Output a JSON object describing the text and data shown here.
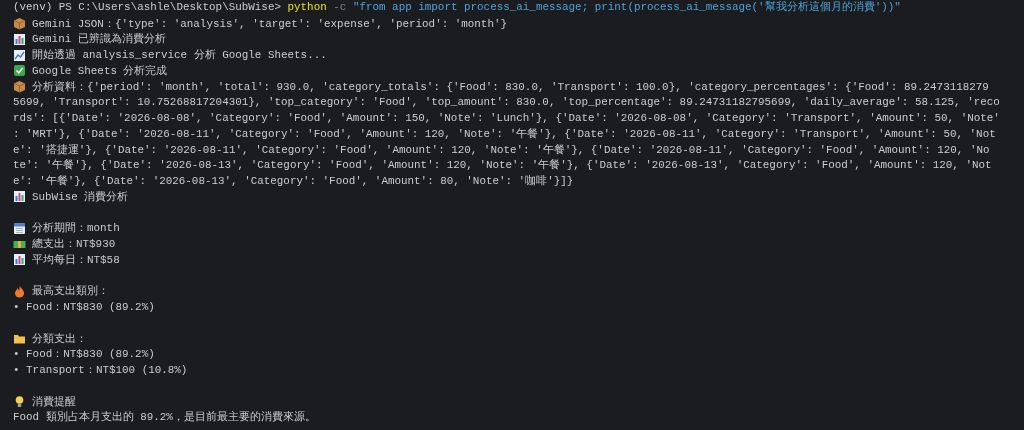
{
  "command": {
    "prompt": "(venv) PS C:\\Users\\ashle\\Desktop\\SubWise>",
    "program": "python",
    "flag": "-c",
    "argument": "\"from app import process_ai_message; print(process_ai_message('幫我分析這個月的消費'))\""
  },
  "lines": [
    {
      "kind": "package",
      "text": "Gemini JSON：{'type': 'analysis', 'target': 'expense', 'period': 'month'}"
    },
    {
      "kind": "bar-chart",
      "text": "Gemini 已辨識為消費分析"
    },
    {
      "kind": "line-chart",
      "text": "開始透過 analysis_service 分析 Google Sheets..."
    },
    {
      "kind": "check",
      "text": "Google Sheets 分析完成"
    },
    {
      "kind": "package",
      "text": "分析資料：{'period': 'month', 'total': 930.0, 'category_totals': {'Food': 830.0, 'Transport': 100.0}, 'category_percentages': {'Food': 89.2473118279"
    },
    {
      "kind": "plain",
      "text": "5699, 'Transport': 10.75268817204301}, 'top_category': 'Food', 'top_amount': 830.0, 'top_percentage': 89.24731182795699, 'daily_average': 58.125, 'reco"
    },
    {
      "kind": "plain",
      "text": "rds': [{'Date': '2026-08-08', 'Category': 'Food', 'Amount': 150, 'Note': 'Lunch'}, {'Date': '2026-08-08', 'Category': 'Transport', 'Amount': 50, 'Note'"
    },
    {
      "kind": "plain",
      "text": ": 'MRT'}, {'Date': '2026-08-11', 'Category': 'Food', 'Amount': 120, 'Note': '午餐'}, {'Date': '2026-08-11', 'Category': 'Transport', 'Amount': 50, 'Not"
    },
    {
      "kind": "plain",
      "text": "e': '搭捷運'}, {'Date': '2026-08-11', 'Category': 'Food', 'Amount': 120, 'Note': '午餐'}, {'Date': '2026-08-11', 'Category': 'Food', 'Amount': 120, 'No"
    },
    {
      "kind": "plain",
      "text": "te': '午餐'}, {'Date': '2026-08-13', 'Category': 'Food', 'Amount': 120, 'Note': '午餐'}, {'Date': '2026-08-13', 'Category': 'Food', 'Amount': 120, 'Not"
    },
    {
      "kind": "plain",
      "text": "e': '午餐'}, {'Date': '2026-08-13', 'Category': 'Food', 'Amount': 80, 'Note': '咖啡'}]}"
    },
    {
      "kind": "bar-chart",
      "text": "SubWise 消費分析"
    },
    {
      "kind": "blank"
    },
    {
      "kind": "calendar",
      "text": "分析期間：month"
    },
    {
      "kind": "banknote",
      "text": "總支出：NT$930"
    },
    {
      "kind": "bar-chart",
      "text": "平均每日：NT$58"
    },
    {
      "kind": "blank"
    },
    {
      "kind": "flame",
      "text": "最高支出類別："
    },
    {
      "kind": "bullet",
      "text": "• Food：NT$830 (89.2%)"
    },
    {
      "kind": "blank"
    },
    {
      "kind": "folder",
      "text": "分類支出："
    },
    {
      "kind": "bullet",
      "text": "• Food：NT$830 (89.2%)"
    },
    {
      "kind": "bullet",
      "text": "• Transport：NT$100 (10.8%)"
    },
    {
      "kind": "blank"
    },
    {
      "kind": "bulb",
      "text": "消費提醒"
    },
    {
      "kind": "plain",
      "text": "Food 類別占本月支出的 89.2%，是目前最主要的消費來源。"
    }
  ]
}
